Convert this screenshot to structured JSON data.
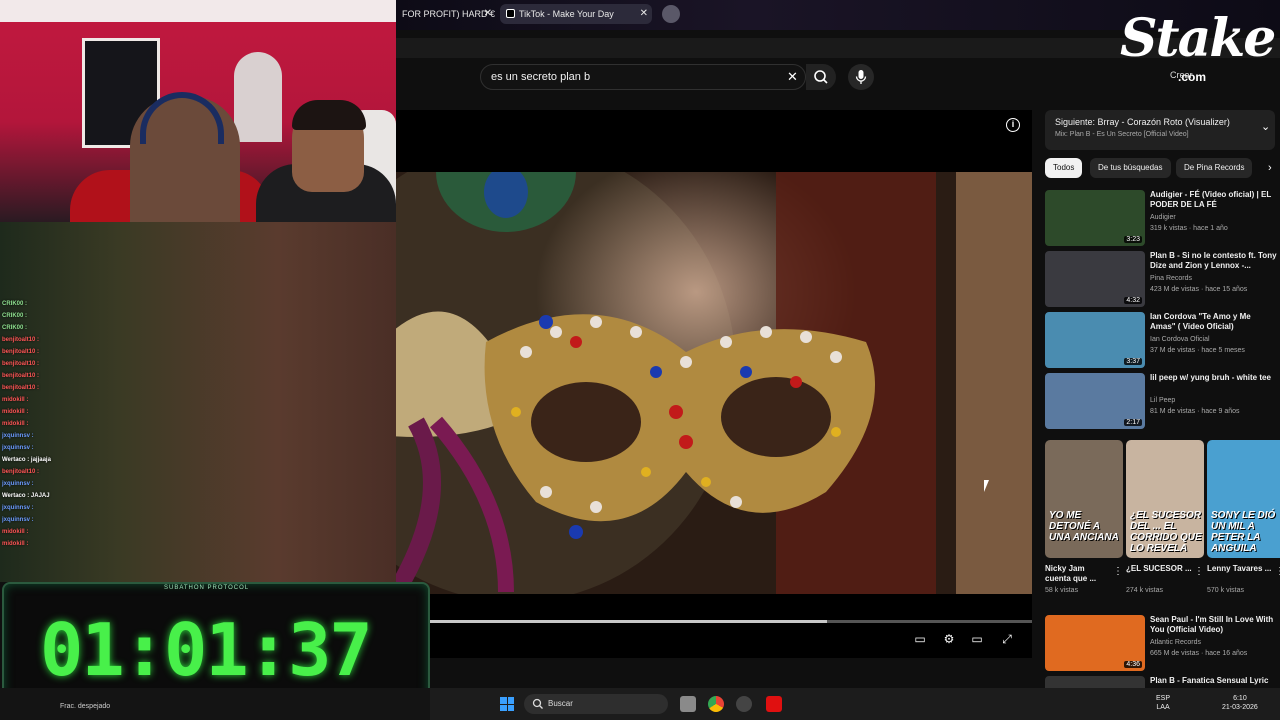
{
  "browser": {
    "tabs": [
      {
        "label": "FOR PROFIT) HARD €"
      },
      {
        "label": "TikTok - Make Your Day"
      }
    ]
  },
  "youtube": {
    "search_value": "es un secreto plan b"
  },
  "stake": {
    "logo": "Stake",
    "domain": ".com",
    "create_label": "Crear"
  },
  "chat": [
    {
      "user": "CRIK00 :",
      "color": "#8fe08f"
    },
    {
      "user": "CRIK00 :",
      "color": "#8fe08f"
    },
    {
      "user": "CRIK00 :",
      "color": "#8fe08f"
    },
    {
      "user": "benjitoalt10 :",
      "color": "#ff5656"
    },
    {
      "user": "benjitoalt10 :",
      "color": "#ff5656"
    },
    {
      "user": "benjitoalt10 :",
      "color": "#ff5656"
    },
    {
      "user": "benjitoalt10 :",
      "color": "#ff5656"
    },
    {
      "user": "benjitoalt10 :",
      "color": "#ff5656"
    },
    {
      "user": "midokiII :",
      "color": "#ff5656"
    },
    {
      "user": "midokiII :",
      "color": "#ff5656"
    },
    {
      "user": "midokiII :",
      "color": "#ff5656"
    },
    {
      "user": "jxquinnsv :",
      "color": "#6c9cff"
    },
    {
      "user": "jxquinnsv :",
      "color": "#6c9cff"
    },
    {
      "user": "Wertaco : jajjaaja",
      "color": "#ffffff"
    },
    {
      "user": "benjitoalt10 :",
      "color": "#ff5656"
    },
    {
      "user": "jxquinnsv :",
      "color": "#6c9cff"
    },
    {
      "user": "Wertaco : JAJAJ",
      "color": "#ffffff"
    },
    {
      "user": "jxquinnsv :",
      "color": "#6c9cff"
    },
    {
      "user": "jxquinnsv :",
      "color": "#6c9cff"
    },
    {
      "user": "midokiII :",
      "color": "#ff5656"
    },
    {
      "user": "midokiII :",
      "color": "#ff5656"
    }
  ],
  "timer": {
    "label": "SUBATHON PROTOCOL",
    "value": "01:01:37"
  },
  "player": {
    "progress_fraction": 0.66
  },
  "sidebar": {
    "next": {
      "title": "Siguiente: Brray - Corazón Roto (Visualizer)",
      "subtitle": "Mix: Plan B - Es Un Secreto [Official Video]"
    },
    "chips": [
      "Todos",
      "De tus búsquedas",
      "De Pina Records"
    ],
    "videos": [
      {
        "title": "Audigier - FÉ (Video oficial) | EL PODER DE LA FÉ",
        "channel": "Audigier",
        "meta": "319 k vistas · hace 1 año",
        "duration": "3:23",
        "thumb": "#2d4a2a"
      },
      {
        "title": "Plan B - Si no le contesto ft. Tony Dize and Zion y Lennox -...",
        "channel": "Pina Records",
        "meta": "423 M de vistas · hace 15 años",
        "duration": "4:32",
        "thumb": "#3a3a40"
      },
      {
        "title": "Ian Cordova \"Te Amo y Me Amas\" ( Video Oficial)",
        "channel": "Ian Cordova Oficial",
        "meta": "37 M de vistas · hace 5 meses",
        "duration": "3:37",
        "thumb": "#4a8cb0"
      },
      {
        "title": "lil peep w/ yung bruh - white tee",
        "channel": "Lil Peep",
        "meta": "81 M de vistas · hace 9 años",
        "duration": "2:17",
        "thumb": "#5a7aa0"
      }
    ],
    "shorts": [
      {
        "caption": "YO ME DETONÉ A UNA ANCIANA",
        "title": "Nicky Jam cuenta que ...",
        "views": "58 k vistas",
        "thumb": "#7a6a5a"
      },
      {
        "caption": "¿EL SUCESOR DEL ... EL CORRIDO QUE LO REVELA",
        "title": "¿EL SUCESOR ...",
        "views": "274 k vistas",
        "thumb": "#c8b4a0"
      },
      {
        "caption": "SONY LE DIÓ UN MIL A PETER LA ANGUILA",
        "title": "Lenny Tavares ...",
        "views": "570 k vistas",
        "thumb": "#4aa0d0"
      }
    ],
    "videos2": [
      {
        "title": "Sean Paul - I'm Still In Love With You (Official Video)",
        "channel": "Atlantic Records",
        "meta": "665 M de vistas · hace 16 años",
        "duration": "4:36",
        "thumb": "#e06a20"
      },
      {
        "title": "Plan B - Fanatica Sensual Lyric",
        "channel": "",
        "meta": "",
        "duration": "",
        "thumb": "#333"
      }
    ]
  },
  "taskbar": {
    "left_text": "Frac. despejado",
    "search_label": "Buscar",
    "lang": "ESP",
    "lang2": "LAA",
    "time": "6:10",
    "date": "21-03-2026"
  }
}
